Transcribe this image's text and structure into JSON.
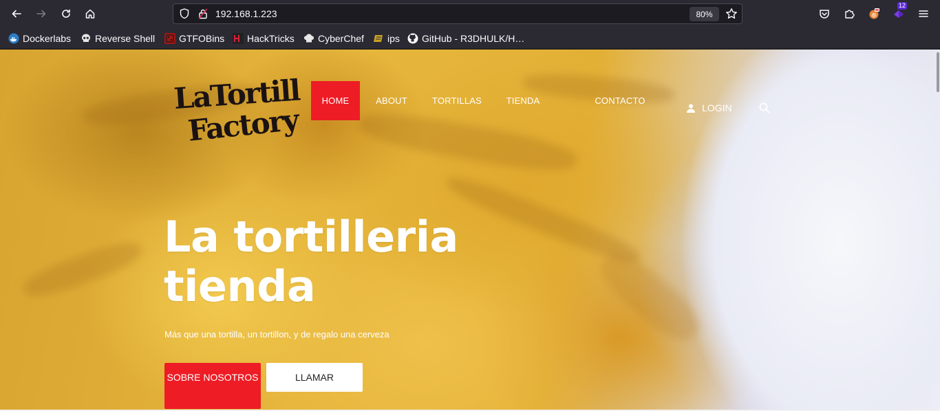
{
  "browser": {
    "url": "192.168.1.223",
    "zoom": "80%",
    "extension_badge": "12",
    "bookmarks": [
      {
        "label": "Dockerlabs",
        "icon": "docker-whale-icon"
      },
      {
        "label": "Reverse Shell",
        "icon": "skull-icon"
      },
      {
        "label": "GTFOBins",
        "icon": "gtfobins-icon"
      },
      {
        "label": "HackTricks",
        "icon": "hacktricks-icon"
      },
      {
        "label": "CyberChef",
        "icon": "chef-hat-icon"
      },
      {
        "label": "ips",
        "icon": "ips-icon"
      },
      {
        "label": "GitHub - R3DHULK/H…",
        "icon": "github-icon"
      }
    ]
  },
  "site": {
    "logo_alt": "La Tortilla Factory",
    "logo_line1": "LaTortilla",
    "logo_line2": "Factory",
    "nav": [
      {
        "label": "HOME",
        "active": true
      },
      {
        "label": "ABOUT",
        "active": false
      },
      {
        "label": "TORTILLAS",
        "active": false
      },
      {
        "label": "TIENDA",
        "active": false
      },
      {
        "label": "CONTACTO",
        "active": false
      }
    ],
    "login_label": "LOGIN",
    "hero": {
      "title_line1": "La tortilleria",
      "title_line2": "tienda",
      "subtitle": "Más que una tortilla, un tortillon, y de regalo una cerveza",
      "primary_button": "SOBRE NOSOTROS",
      "secondary_button": "LLAMAR"
    }
  },
  "colors": {
    "accent_red": "#ee1c25",
    "chrome_bg": "#2b2a33"
  }
}
